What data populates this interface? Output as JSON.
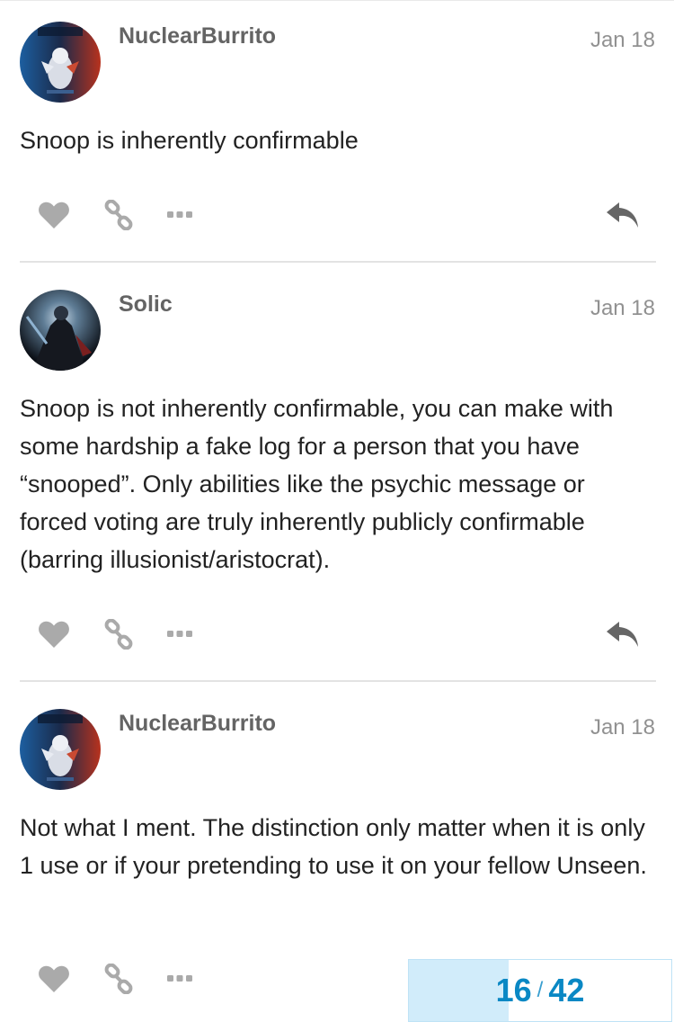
{
  "posts": [
    {
      "username": "NuclearBurrito",
      "date": "Jan 18",
      "avatar_icon": "nuclearburrito-avatar",
      "body": "Snoop is inherently confirmable"
    },
    {
      "username": "Solic",
      "date": "Jan 18",
      "avatar_icon": "solic-avatar",
      "body": "Snoop is not inherently confirmable, you can make with some hardship a fake log for a person that you have “snooped”. Only abilities like the psychic message or forced voting are truly inherently publicly confirmable (barring illusionist/aristocrat)."
    },
    {
      "username": "NuclearBurrito",
      "date": "Jan 18",
      "avatar_icon": "nuclearburrito-avatar",
      "body": "Not what I ment. The distinction only matter when it is only 1 use or if your pretending to use it on your fellow Unseen."
    }
  ],
  "action_icons": [
    "heart-icon",
    "link-icon",
    "more-icon",
    "reply-icon"
  ],
  "progress": {
    "current": "16",
    "separator": "/",
    "total": "42",
    "fraction": 0.381
  },
  "colors": {
    "username": "#646464",
    "date": "#919191",
    "icon": "#aaaaaa",
    "reply_icon": "#666666",
    "progress_text": "#0a88c4",
    "progress_fill": "#d1ecfa"
  }
}
